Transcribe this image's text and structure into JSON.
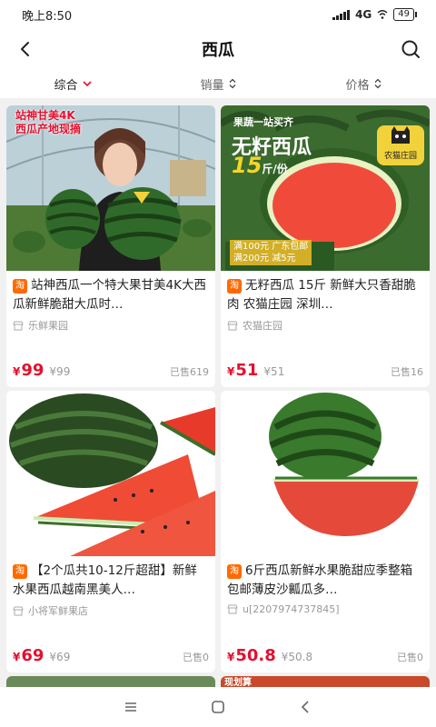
{
  "status_bar": {
    "time": "晚上8:50",
    "network": "4G",
    "battery": "49"
  },
  "nav": {
    "title": "西瓜"
  },
  "sort": [
    {
      "label": "综合",
      "icon": "chevron-down-icon"
    },
    {
      "label": "销量",
      "icon": "sort-arrows-icon"
    },
    {
      "label": "价格",
      "icon": "sort-arrows-icon"
    }
  ],
  "accent_color": "#e4102e",
  "products": [
    {
      "banner_line1": "站神甘美4K",
      "banner_line2": "西瓜产地现摘",
      "tag": "淘",
      "title": "站神西瓜一个特大果甘美4K大西瓜新鲜脆甜大瓜时…",
      "shop": "乐鲜果园",
      "price_symbol": "¥",
      "price": "99",
      "original_price": "¥99",
      "sold": "已售619"
    },
    {
      "banner_top": "果蔬一站买齐",
      "banner_title": "无籽西瓜",
      "banner_weight": "15",
      "banner_unit": "斤/份",
      "banner_brand": "农猫庄园",
      "promo_line1": "满100元 广东包邮",
      "promo_line2": "满200元 减5元",
      "tag": "淘",
      "title": "无籽西瓜 15斤 新鲜大只香甜脆肉 农猫庄园 深圳…",
      "shop": "农猫庄园",
      "price_symbol": "¥",
      "price": "51",
      "original_price": "¥51",
      "sold": "已售16"
    },
    {
      "tag": "淘",
      "title": "【2个瓜共10-12斤超甜】新鲜水果西瓜越南黑美人…",
      "shop": "小将军鲜果店",
      "price_symbol": "¥",
      "price": "69",
      "original_price": "¥69",
      "sold": "已售0"
    },
    {
      "tag": "淘",
      "title": "6斤西瓜新鲜水果脆甜应季整箱包邮薄皮沙瓤瓜多…",
      "shop": "u[2207974737845]",
      "price_symbol": "¥",
      "price": "50.8",
      "original_price": "¥50.8",
      "sold": "已售0"
    }
  ],
  "peek_label": "现划算"
}
